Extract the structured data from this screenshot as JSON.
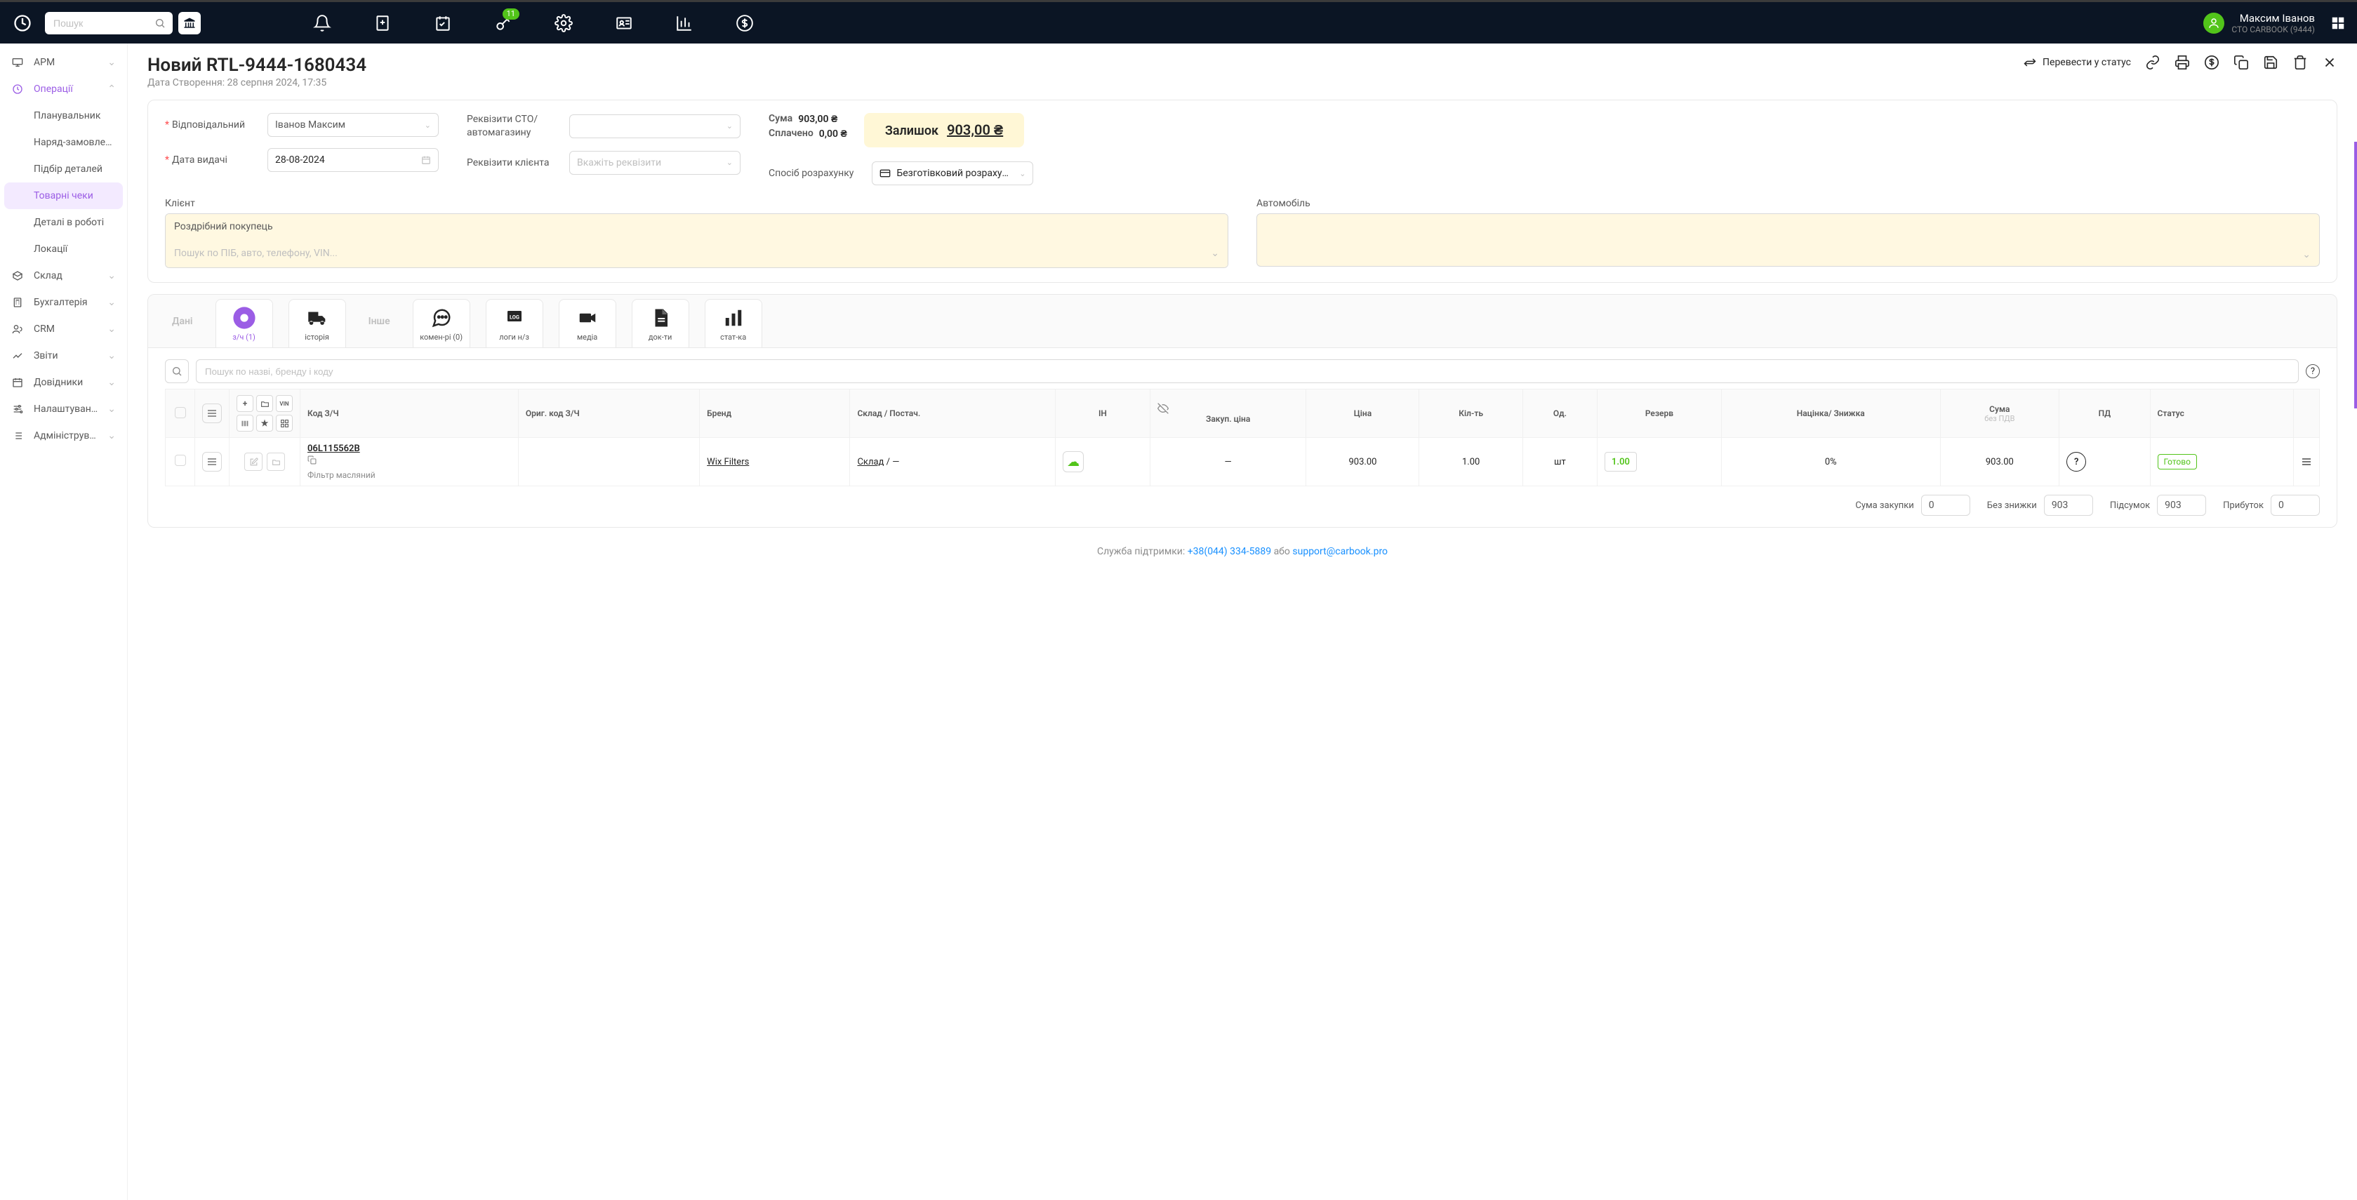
{
  "topbar": {
    "search_placeholder": "Пошук",
    "badge": "11",
    "username": "Максим Іванов",
    "usersub": "СТО CARBOOK (9444)"
  },
  "sidebar": {
    "items": [
      {
        "label": "АРМ"
      },
      {
        "label": "Операції"
      },
      {
        "label": "Склад"
      },
      {
        "label": "Бухгалтерія"
      },
      {
        "label": "CRM"
      },
      {
        "label": "Звіти"
      },
      {
        "label": "Довідники"
      },
      {
        "label": "Налаштування"
      },
      {
        "label": "Адмініструва..."
      }
    ],
    "ops_sub": [
      "Планувальник",
      "Наряд-замовлен...",
      "Підбір деталей",
      "Товарні чеки",
      "Деталі в роботі",
      "Локації"
    ]
  },
  "page": {
    "title": "Новий RTL-9444-1680434",
    "created_label": "Дата Створення: 28 серпня 2024, 17:35",
    "status_action": "Перевести у статус"
  },
  "form": {
    "responsible_label": "Відповідальний",
    "responsible_value": "Іванов Максим",
    "date_label": "Дата видачі",
    "date_value": "28-08-2024",
    "sto_req_label": "Реквізити СТО/ автомагазину",
    "client_req_label": "Реквізити клієнта",
    "client_req_placeholder": "Вкажіть реквізити",
    "sum_label": "Сума",
    "sum_value": "903,00 ₴",
    "paid_label": "Сплачено",
    "paid_value": "0,00 ₴",
    "remain_label": "Залишок",
    "remain_value": "903,00 ₴",
    "paymethod_label": "Спосіб розрахунку",
    "paymethod_value": "Безготівковий розрахунок (..."
  },
  "cv": {
    "client_label": "Клієнт",
    "client_value": "Роздрібний покупець",
    "client_search_placeholder": "Пошук по ПІБ, авто, телефону, VIN...",
    "vehicle_label": "Автомобіль"
  },
  "tabs": {
    "data": "Дані",
    "more": "Інше",
    "parts": "з/ч (1)",
    "history": "історія",
    "comments": "комен-рі (0)",
    "logs": "логи н/з",
    "media": "медіа",
    "docs": "док-ти",
    "stats": "стат-ка"
  },
  "table": {
    "search_placeholder": "Пошук по назві, бренду і коду",
    "headers": {
      "code": "Код З/Ч",
      "orig_code": "Ориг. код З/Ч",
      "brand": "Бренд",
      "stock": "Склад / Постач.",
      "in": "ІН",
      "purchase_price": "Закуп. ціна",
      "price": "Ціна",
      "qty": "Кіл-ть",
      "unit": "Од.",
      "reserve": "Резерв",
      "markup": "Націнка/ Знижка",
      "sum": "Сума",
      "sum_sub": "без ПДВ",
      "vat": "ПД",
      "status": "Статус"
    },
    "row": {
      "code": "06L115562B",
      "desc": "Фільтр масляний",
      "brand": "Wix Filters",
      "stock": "Склад",
      "stock_suffix": " / —",
      "purchase": "—",
      "price": "903.00",
      "qty": "1.00",
      "unit": "шт",
      "reserve": "1.00",
      "markup": "0%",
      "sum": "903.00",
      "status": "Готово"
    },
    "totals": {
      "purchase_label": "Сума закупки",
      "purchase_value": "0",
      "nodiscount_label": "Без знижки",
      "nodiscount_value": "903",
      "total_label": "Підсумок",
      "total_value": "903",
      "profit_label": "Прибуток",
      "profit_value": "0"
    }
  },
  "footer": {
    "prefix": "Служба підтримки: ",
    "phone": "+38(044) 334-5889",
    "or": " або ",
    "email": "support@carbook.pro"
  }
}
